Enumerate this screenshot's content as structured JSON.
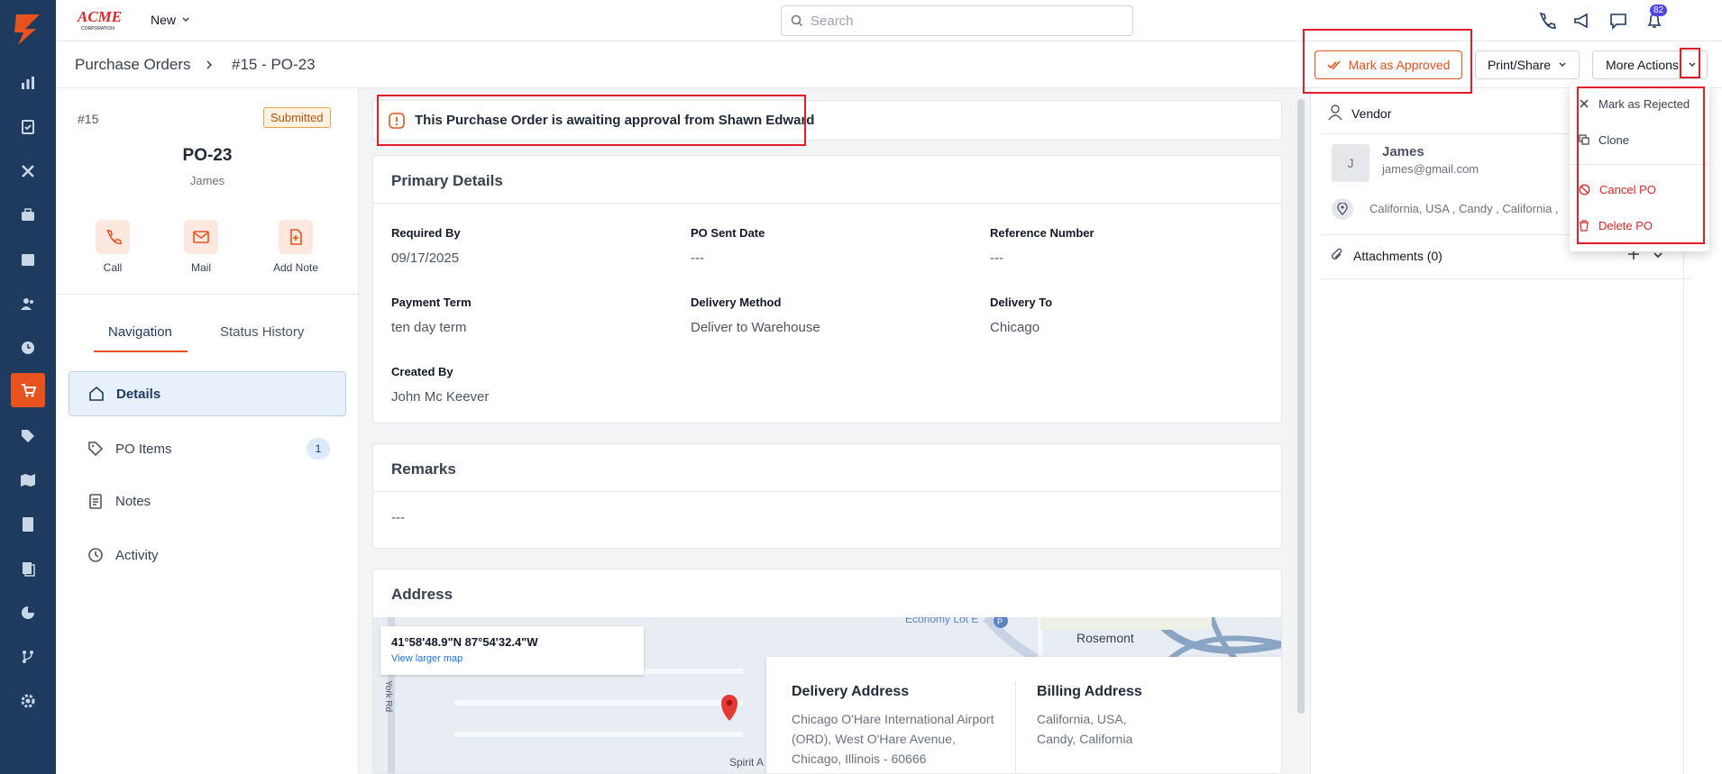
{
  "brand": {
    "name": "ACME CORPORATION"
  },
  "topbar": {
    "new_label": "New",
    "search_placeholder": "Search",
    "notification_count": "82"
  },
  "breadcrumb": {
    "root": "Purchase Orders",
    "current": "#15 - PO-23"
  },
  "actions": {
    "approve_label": "Mark as Approved",
    "print_label": "Print/Share",
    "more_label": "More Actions"
  },
  "more_menu": {
    "items": [
      {
        "label": "Mark as Rejected",
        "icon": "close-icon"
      },
      {
        "label": "Clone",
        "icon": "copy-icon"
      },
      {
        "label": "Cancel PO",
        "icon": "ban-icon",
        "danger": true
      },
      {
        "label": "Delete PO",
        "icon": "trash-icon",
        "danger": true
      }
    ]
  },
  "po": {
    "number": "#15",
    "status": "Submitted",
    "title": "PO-23",
    "vendor_name": "James"
  },
  "quick_actions": {
    "call": "Call",
    "mail": "Mail",
    "note": "Add Note"
  },
  "tabs": {
    "navigation": "Navigation",
    "status_history": "Status History"
  },
  "nav": {
    "details": "Details",
    "po_items": "PO Items",
    "po_items_count": "1",
    "notes": "Notes",
    "activity": "Activity"
  },
  "alert": {
    "text": "This Purchase Order is awaiting approval from Shawn Edward"
  },
  "primary": {
    "title": "Primary Details",
    "fields": [
      {
        "label": "Required By",
        "value": "09/17/2025"
      },
      {
        "label": "PO Sent Date",
        "value": "---"
      },
      {
        "label": "Reference Number",
        "value": "---"
      },
      {
        "label": "Payment Term",
        "value": "ten day term"
      },
      {
        "label": "Delivery Method",
        "value": "Deliver to Warehouse"
      },
      {
        "label": "Delivery To",
        "value": "Chicago"
      },
      {
        "label": "Created By",
        "value": "John Mc Keever"
      }
    ]
  },
  "remarks": {
    "title": "Remarks",
    "value": "---"
  },
  "address": {
    "title": "Address",
    "coords": "41°58'48.9\"N 87°54'32.4\"W",
    "map_link": "View larger map",
    "map_labels": {
      "economy": "Economy Lot E",
      "rosemont": "Rosemont",
      "york": "York Rd",
      "spirit": "Spirit A"
    },
    "delivery_title": "Delivery Address",
    "delivery_lines": [
      "Chicago O'Hare International Airport",
      "(ORD), West O'Hare Avenue,",
      "Chicago, Illinois - 60666"
    ],
    "billing_title": "Billing Address",
    "billing_lines": [
      "California, USA,",
      "Candy, California"
    ]
  },
  "vendor_panel": {
    "title": "Vendor",
    "initial": "J",
    "name": "James",
    "email": "james@gmail.com",
    "location": "California, USA , Candy , California ,",
    "attachments": "Attachments (0)"
  },
  "colors": {
    "accent": "#e8521e",
    "sidebar": "#1e3a5f",
    "highlight": "#e11d2a"
  }
}
